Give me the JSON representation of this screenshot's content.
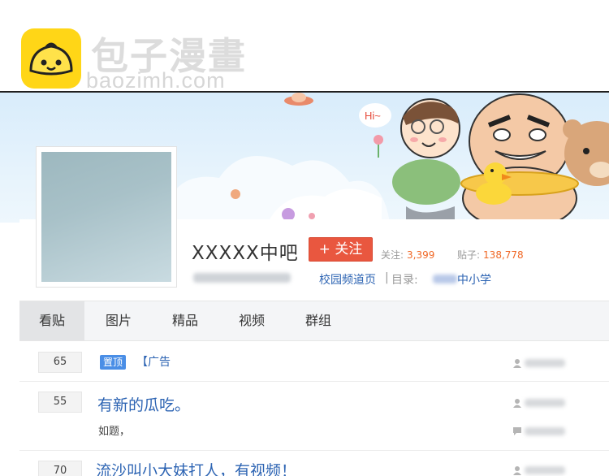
{
  "watermark": {
    "title": "包子漫畫",
    "url": "baozimh.com"
  },
  "banner": {
    "speech": "Hi~"
  },
  "forum": {
    "name": "XXXXX中吧",
    "follow_label": "+ 关注",
    "followers_label": "关注:",
    "followers_value": "3,399",
    "posts_label": "贴子:",
    "posts_value": "138,778",
    "category_link": "校园频道页",
    "category_sep": "|",
    "category_label": "目录:",
    "category_value": "中小学"
  },
  "tabs": [
    "看贴",
    "图片",
    "精品",
    "视频",
    "群组"
  ],
  "threads": [
    {
      "replies": "65",
      "tag": "置顶",
      "title": "【广告"
    },
    {
      "replies": "55",
      "title": "有新的瓜吃。",
      "abstract": "如题，"
    },
    {
      "replies": "70",
      "title": "流沙叫小大妹打人，有视频！"
    }
  ],
  "colors": {
    "accent_blue": "#2d64b3",
    "follow_red": "#e9573f",
    "stat_orange": "#f06826",
    "watermark_yellow": "#ffd617"
  },
  "icons": [
    "bun-logo-icon",
    "user-icon",
    "comment-icon"
  ]
}
